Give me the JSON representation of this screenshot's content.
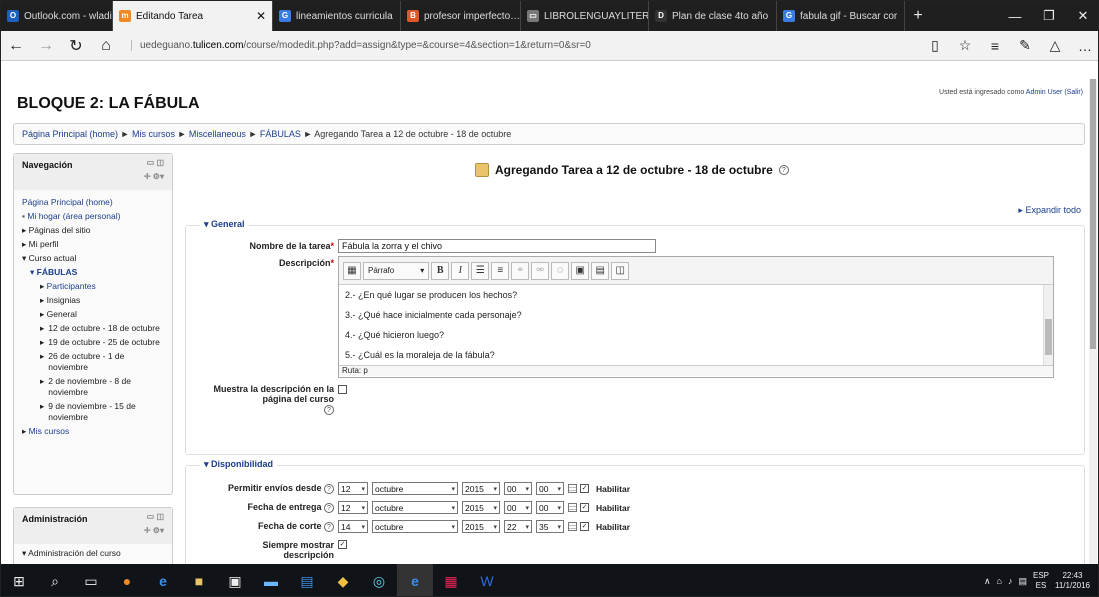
{
  "tabs": [
    {
      "label": "Outlook.com - wladile",
      "icon": "outlook-icon",
      "color": "#1f5fbf",
      "glyph": "O"
    },
    {
      "label": "Editando Tarea",
      "icon": "moodle-icon",
      "color": "#f08a24",
      "glyph": "m",
      "active": true
    },
    {
      "label": "lineamientos curricula",
      "icon": "google-icon",
      "color": "#3b7be6",
      "glyph": "G"
    },
    {
      "label": "profesor imperfecto…",
      "icon": "blogger-icon",
      "color": "#e2562b",
      "glyph": "B"
    },
    {
      "label": "LIBROLENGUAYLITERA",
      "icon": "document-icon",
      "color": "#777",
      "glyph": "▭"
    },
    {
      "label": "Plan de clase 4to año",
      "icon": "doc-icon",
      "color": "#333",
      "glyph": "D"
    },
    {
      "label": "fabula gif - Buscar cor",
      "icon": "google-icon",
      "color": "#3b7be6",
      "glyph": "G"
    }
  ],
  "address": {
    "url_prefix": "uedeguano.",
    "url_domain": "tulicen.com",
    "url_path": "/course/modedit.php?add=assign&type=&course=4&section=1&return=0&sr=0"
  },
  "site": {
    "title": "BLOQUE 2: LA FÁBULA",
    "logged_prefix": "Usted está ingresado como ",
    "logged_user": "Admin User",
    "logged_exit": "(Salir)"
  },
  "breadcrumb": {
    "home": "Página Principal (home)",
    "courses": "Mis cursos",
    "misc": "Miscellaneous",
    "fabulas": "FÁBULAS",
    "current": "Agregando Tarea a 12 de octubre - 18 de octubre",
    "sep": " ► "
  },
  "nav_block": {
    "title": "Navegación",
    "home": "Página Principal (home)",
    "items": [
      "Mi hogar (área personal)",
      "Páginas del sitio",
      "Mi perfil",
      "Curso actual",
      "FÁBULAS",
      "Participantes",
      "Insignias",
      "General",
      "12 de octubre - 18 de octubre",
      "19 de octubre - 25 de octubre",
      "26 de octubre - 1 de noviembre",
      "2 de noviembre - 8 de noviembre",
      "9 de noviembre - 15 de noviembre",
      "Mis cursos"
    ]
  },
  "admin_block": {
    "title": "Administración",
    "first_item": "Administración del curso"
  },
  "main": {
    "page_title": "Agregando Tarea a 12 de octubre - 18 de octubre",
    "expand_all": "Expandir todo"
  },
  "general": {
    "legend": "General",
    "name_label": "Nombre de la tarea",
    "name_value": "Fábula la zorra y el chivo",
    "desc_label": "Descripción",
    "format": "Párrafo",
    "lines": [
      "2.- ¿En qué lugar se producen los hechos?",
      "3.- ¿Qué hace inicialmente cada personaje?",
      "4.- ¿Qué hicieron luego?",
      "5.- ¿Cuál es la moraleja de la fábula?"
    ],
    "path": "Ruta: p",
    "show_desc_label": "Muestra la descripción en la página del curso"
  },
  "availability": {
    "legend": "Disponibilidad",
    "rows": [
      {
        "label": "Permitir envíos desde",
        "day": "12",
        "month": "octubre",
        "year": "2015",
        "hour": "00",
        "minute": "00",
        "enable": "Habilitar"
      },
      {
        "label": "Fecha de entrega",
        "day": "12",
        "month": "octubre",
        "year": "2015",
        "hour": "00",
        "minute": "00",
        "enable": "Habilitar"
      },
      {
        "label": "Fecha de corte",
        "day": "14",
        "month": "octubre",
        "year": "2015",
        "hour": "22",
        "minute": "35",
        "enable": "Habilitar"
      }
    ],
    "always_show_label": "Siempre mostrar descripción"
  },
  "taskbar": {
    "lang_top": "ESP",
    "lang_bottom": "ES",
    "time": "22:43",
    "date": "11/1/2016"
  },
  "colors": {
    "link": "#1a3e8c",
    "required": "#c00",
    "tabbar": "#1f1f1f",
    "taskbar": "#101418"
  }
}
